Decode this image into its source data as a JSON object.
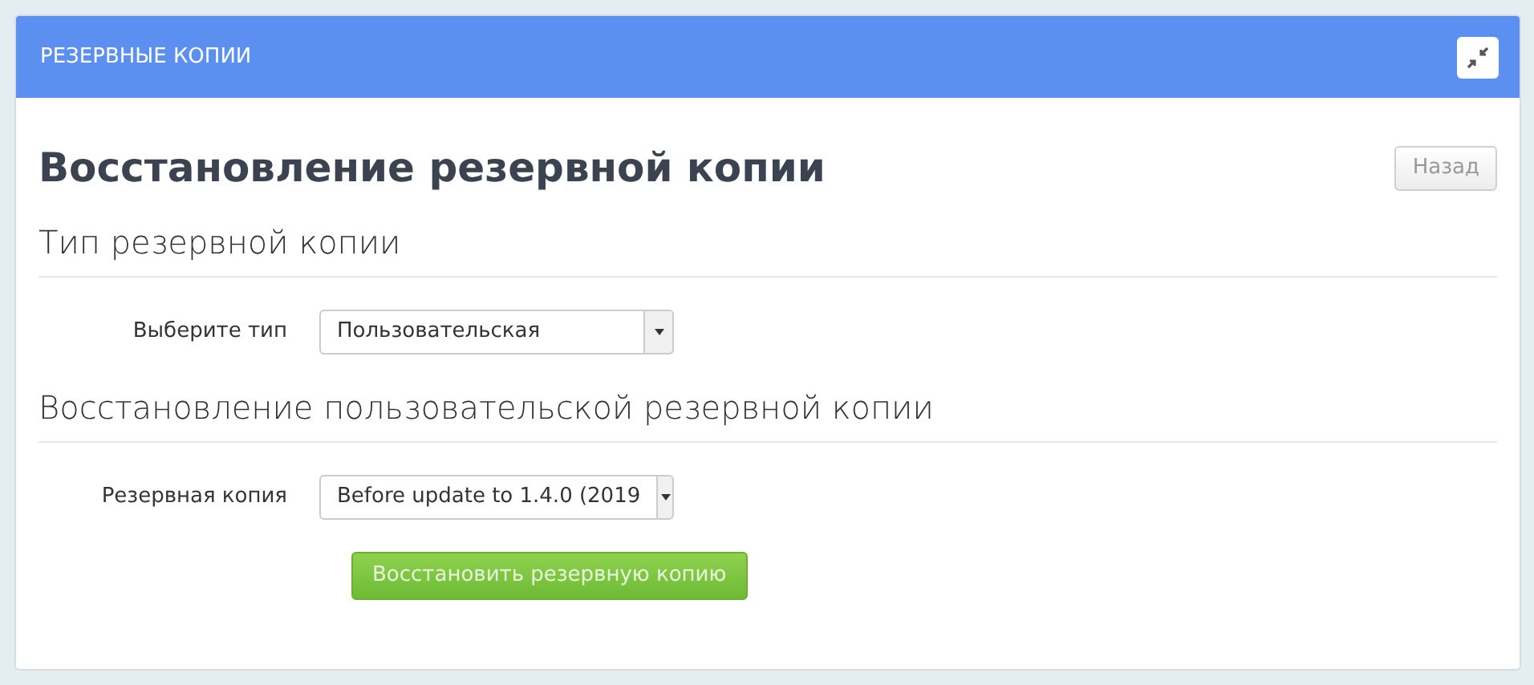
{
  "panel": {
    "title": "РЕЗЕРВНЫЕ КОПИИ"
  },
  "page": {
    "heading": "Восстановление резервной копии",
    "back_button": "Назад"
  },
  "sections": [
    {
      "title": "Тип резервной копии",
      "fields": [
        {
          "kind": "select",
          "label": "Выберите тип",
          "value": "Пользовательская"
        }
      ]
    },
    {
      "title": "Восстановление пользовательской резервной копии",
      "fields": [
        {
          "kind": "select",
          "label": "Резервная копия",
          "value": "Before update to 1.4.0 (2019"
        },
        {
          "kind": "button",
          "label": "Восстановить резервную копию"
        }
      ]
    }
  ]
}
